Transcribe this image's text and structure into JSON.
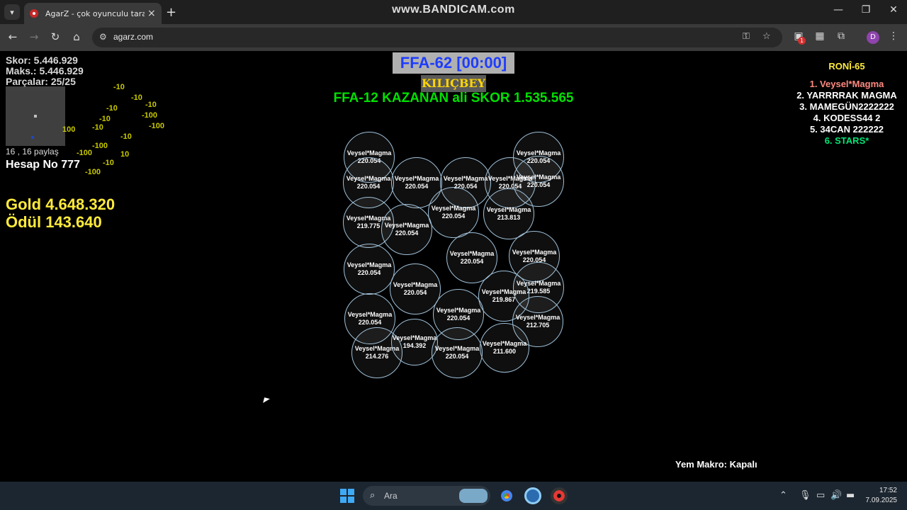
{
  "watermark": "www.BANDICAM.com",
  "browser": {
    "tab_title": "AgarZ - çok oyunculu tarayıcı oyunu",
    "url": "agarz.com",
    "profile_initial": "D",
    "ext_badge": "1"
  },
  "hud": {
    "score": "Skor: 5.446.929",
    "max": "Maks.: 5.446.929",
    "pieces": "Parçalar: 25/25",
    "shares": "16 , 16 paylaş",
    "account": "Hesap No 777",
    "gold": "Gold 4.648.320",
    "reward": "Ödül 143.640",
    "food_labels": [
      "-10",
      "-10",
      "-10",
      "-10",
      "-100",
      "-10",
      "-100",
      "-10",
      "100",
      "-10",
      "-100",
      "-100",
      "10",
      "-10",
      "-100"
    ]
  },
  "top": {
    "room": "FFA-62 [00:00]",
    "logo": "KILIÇBEY",
    "winner": "FFA-12 KAZANAN ali SKOR 1.535.565"
  },
  "leaderboard": {
    "title": "RONÎ-65",
    "items": [
      "1. Veysel*Magma",
      "2. YARRRRAK MAGMA",
      "3. MAMEGÜN2222222",
      "4. KODESS44 2",
      "5. 34CAN 222222",
      "6. STARS*"
    ]
  },
  "cells": [
    {
      "name": "Veysel*Magma",
      "mass": "220.054"
    },
    {
      "name": "Veysel*Magma",
      "mass": "220.054"
    },
    {
      "name": "Veysel*Magma",
      "mass": "220.054"
    },
    {
      "name": "Veysel*Magma",
      "mass": "220.054"
    },
    {
      "name": "Veysel*Magma",
      "mass": "220.054"
    },
    {
      "name": "Veysel*Magma",
      "mass": "220.054"
    },
    {
      "name": "Veysel*Magma",
      "mass": "220.054"
    },
    {
      "name": "Veysel*Magma",
      "mass": "220.054"
    },
    {
      "name": "Veysel*Magma",
      "mass": "220.054"
    },
    {
      "name": "Veysel*Magma",
      "mass": "220.054"
    },
    {
      "name": "Veysel*Magma",
      "mass": "213.813"
    },
    {
      "name": "Veysel*Magma",
      "mass": "219.775"
    },
    {
      "name": "Veysel*Magma",
      "mass": "220.054"
    },
    {
      "name": "Veysel*Magma",
      "mass": "220.054"
    },
    {
      "name": "Veysel*Magma",
      "mass": "220.054"
    },
    {
      "name": "Veysel*Magma",
      "mass": "220.054"
    },
    {
      "name": "Veysel*Magma",
      "mass": "219.585"
    },
    {
      "name": "Veysel*Magma",
      "mass": "219.867"
    },
    {
      "name": "Veysel*Magma",
      "mass": "220.054"
    },
    {
      "name": "Veysel*Magma",
      "mass": "220.054"
    },
    {
      "name": "Veysel*Magma",
      "mass": "212.705"
    },
    {
      "name": "Veysel*Magma",
      "mass": "214.276"
    },
    {
      "name": "Veysel*Magma",
      "mass": "194.392"
    },
    {
      "name": "Veysel*Magma",
      "mass": "220.054"
    },
    {
      "name": "Veysel*Magma",
      "mass": "211.600"
    }
  ],
  "macro_status": "Yem Makro: Kapalı",
  "taskbar": {
    "search_placeholder": "Ara",
    "time": "17:52",
    "date": "7.09.2025"
  }
}
